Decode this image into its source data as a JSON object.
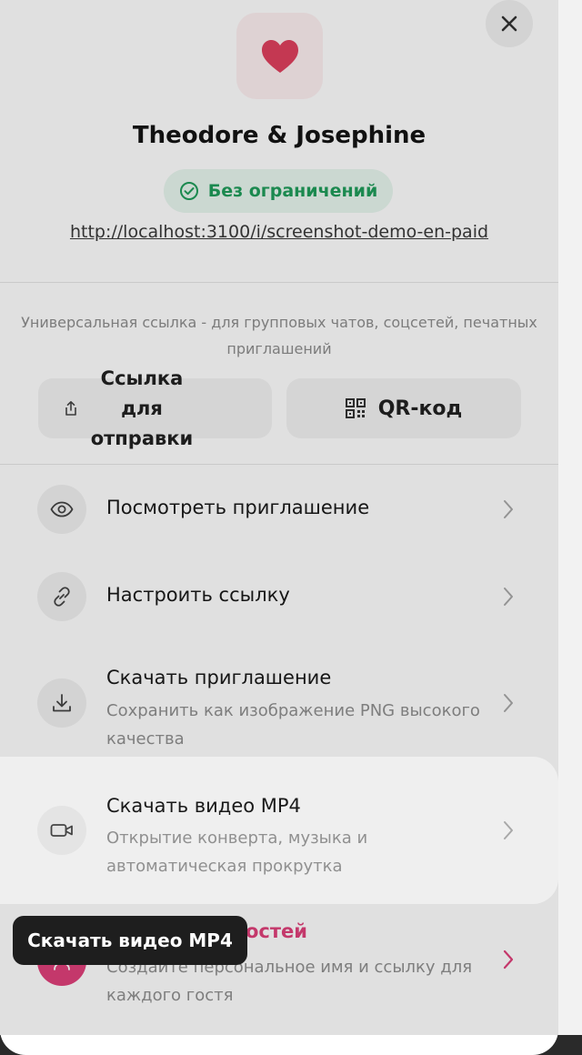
{
  "header": {
    "close_icon": "close-icon",
    "app_icon": "heart-icon",
    "title": "Theodore & Josephine",
    "status_text": "Без ограничений",
    "status_icon": "check-circle-icon",
    "link_url": "http://localhost:3100/i/screenshot-demo-en-paid"
  },
  "share": {
    "description": "Универсальная ссылка - для групповых чатов, соцсетей, печатных приглашений",
    "share_button_label": "Ссылка для отправки",
    "share_icon": "share-icon",
    "qr_button_label": "QR-код",
    "qr_icon": "qr-code-icon"
  },
  "menu": {
    "items": [
      {
        "title": "Посмотреть приглашение",
        "subtitle": "",
        "icon": "eye-icon"
      },
      {
        "title": "Настроить ссылку",
        "subtitle": "",
        "icon": "link-icon"
      },
      {
        "title": "Скачать приглашение",
        "subtitle": "Сохранить как изображение PNG высокого качества",
        "icon": "download-icon"
      },
      {
        "title": "Скачать видео MP4",
        "subtitle": "Открытие конверта, музыка и автоматическая прокрутка",
        "icon": "video-icon"
      },
      {
        "title": "остей",
        "subtitle": "Создайте персональное имя и ссылку для каждого гостя",
        "icon": "guests-icon"
      }
    ]
  },
  "tooltip": {
    "text": "Скачать видео MP4"
  },
  "colors": {
    "accent_pink": "#e0407a",
    "status_green": "#1f9d5a",
    "heart_red": "#e0405e"
  }
}
